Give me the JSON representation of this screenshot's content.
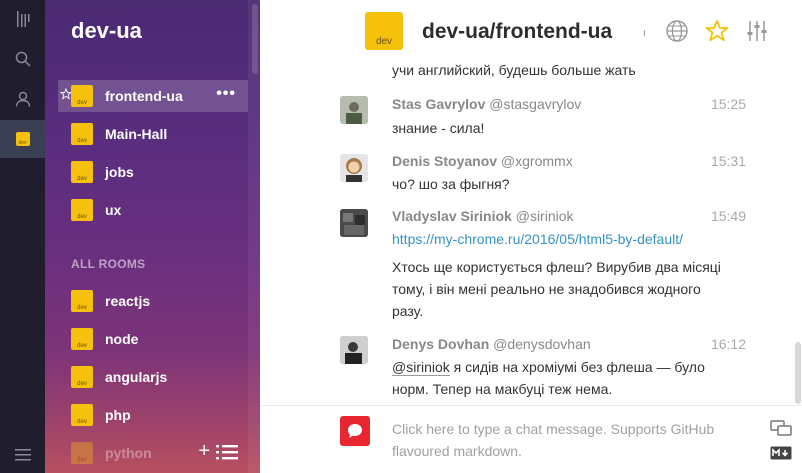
{
  "rail": {
    "items": [
      {
        "icon": "gitter-logo-icon"
      },
      {
        "icon": "search-icon"
      },
      {
        "icon": "user-icon"
      },
      {
        "icon": "community-dev-ua-icon",
        "tile_text": "dev"
      }
    ],
    "bottom_icon": "menu-icon"
  },
  "sidebar": {
    "title": "dev-ua",
    "rooms": [
      {
        "label": "frontend-ua",
        "tile_text": "dev",
        "active": true
      },
      {
        "label": "Main-Hall",
        "tile_text": "dev"
      },
      {
        "label": "jobs",
        "tile_text": "dev"
      },
      {
        "label": "ux",
        "tile_text": "dev"
      }
    ],
    "section_label": "ALL ROOMS",
    "all_rooms": [
      {
        "label": "reactjs",
        "tile_text": "dev"
      },
      {
        "label": "node",
        "tile_text": "dev"
      },
      {
        "label": "angularjs",
        "tile_text": "dev"
      },
      {
        "label": "php",
        "tile_text": "dev"
      },
      {
        "label": "python",
        "tile_text": "dev"
      }
    ],
    "more_label": "•••",
    "add_label": "+"
  },
  "header": {
    "title": "dev-ua/frontend-ua",
    "tile_text": "dev",
    "mark": "ı",
    "accent_color": "#f5c10c"
  },
  "messages": {
    "partial_text": "учи английский, будешь больше жать",
    "items": [
      {
        "author": "Stas Gavrylov",
        "handle": "@stasgavrylov",
        "time": "15:25",
        "lines": [
          "знание - сила!"
        ]
      },
      {
        "author": "Denis Stoyanov",
        "handle": "@xgrommx",
        "time": "15:31",
        "lines": [
          "чо? шо за фыгня?"
        ]
      },
      {
        "author": "Vladyslav Siriniok",
        "handle": "@siriniok",
        "time": "15:49",
        "link": "https://my-chrome.ru/2016/05/html5-by-default/",
        "lines": [
          "Хтось ще користується флеш? Вирубив два місяці",
          "тому, і він мені реально не знадобився жодного",
          "разу."
        ]
      },
      {
        "author": "Denys Dovhan",
        "handle": "@denysdovhan",
        "time": "16:12",
        "mention": "@siriniok",
        "first_line_rest": " я сидів на хроміумі без флеша — було",
        "lines": [
          "норм. Тепер на макбуці теж нема."
        ]
      }
    ]
  },
  "composer": {
    "placeholder_line1": "Click here to type a chat message. Supports GitHub",
    "placeholder_line2": "flavoured markdown.",
    "avatar_color": "#e8262f"
  }
}
